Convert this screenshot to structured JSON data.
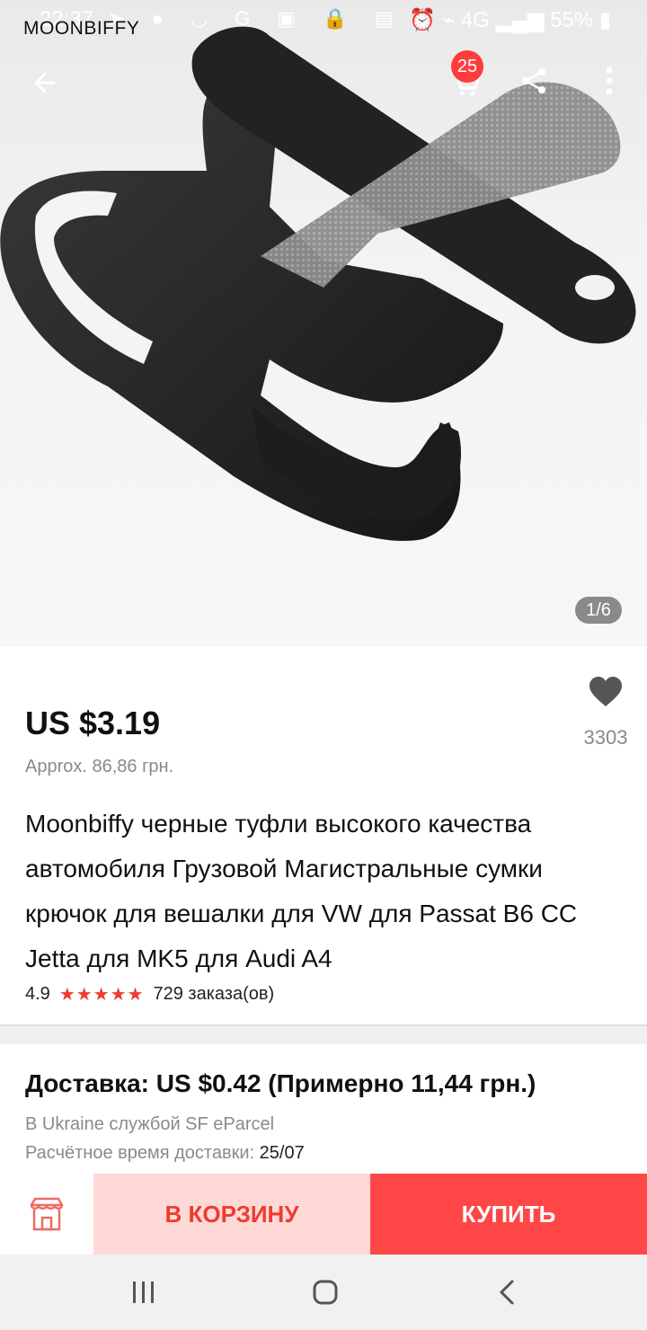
{
  "status": {
    "time": "22:37",
    "left_icons": "➤ ● ◡ G ▣ 🔒 ▤",
    "right": "⏰ ⌁ 4G ▂▄▆ 55% ▮"
  },
  "brand": {
    "text": "MOONBIFFY"
  },
  "cart": {
    "badge": "25"
  },
  "gallery": {
    "counter": "1/6"
  },
  "product": {
    "price": "US $3.19",
    "approx": "Approx. 86,86 грн.",
    "wish_count": "3303",
    "title": "Moonbiffy черные туфли высокого качества автомобиля Грузовой Магистральные сумки крючок для вешалки для VW для Passat B6 CC Jetta для MK5 для Audi A4",
    "rating": "4.9",
    "stars": "★★★★★",
    "orders": "729 заказа(ов)"
  },
  "shipping": {
    "line": "Доставка: US $0.42 (Примерно 11,44 грн.)",
    "service": "В Ukraine службой SF eParcel",
    "eta_label": "Расчётное время доставки:",
    "eta_value": "25/07"
  },
  "actions": {
    "add_to_cart": "В КОРЗИНУ",
    "buy": "КУПИТЬ"
  },
  "colors": {
    "accent": "#ff4747",
    "accent_light": "#ffd9d6",
    "star": "#ef3b2f"
  }
}
